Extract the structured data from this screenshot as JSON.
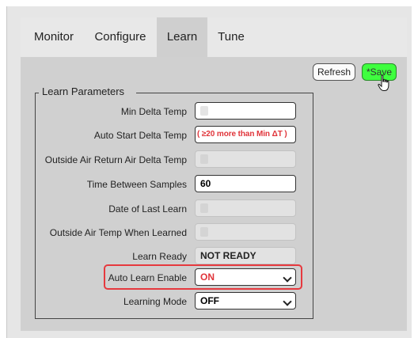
{
  "tabs": [
    {
      "label": "Monitor",
      "active": false
    },
    {
      "label": "Configure",
      "active": false
    },
    {
      "label": "Learn",
      "active": true
    },
    {
      "label": "Tune",
      "active": false
    }
  ],
  "toolbar": {
    "refresh_label": "Refresh",
    "save_label": "*Save"
  },
  "group": {
    "legend": "Learn Parameters"
  },
  "fields": {
    "min_delta_temp": {
      "label": "Min Delta Temp",
      "value": ""
    },
    "auto_start_delta_temp": {
      "label": "Auto Start Delta Temp",
      "placeholder": "( ≥20 more than Min ΔT )"
    },
    "oa_return_air_delta_temp": {
      "label": "Outside Air Return Air Delta Temp",
      "value": ""
    },
    "time_between_samples": {
      "label": "Time Between Samples",
      "value": "60"
    },
    "date_of_last_learn": {
      "label": "Date of Last Learn",
      "value": ""
    },
    "outside_air_temp_when_learned": {
      "label": "Outside Air Temp When Learned",
      "value": ""
    },
    "learn_ready": {
      "label": "Learn Ready",
      "value": "NOT READY"
    },
    "auto_learn_enable": {
      "label": "Auto Learn Enable",
      "value": "ON"
    },
    "learning_mode": {
      "label": "Learning Mode",
      "value": "OFF"
    }
  },
  "colors": {
    "accent_red": "#e6393e",
    "save_green": "#3fff3f",
    "hint_red": "#e0343a"
  },
  "icons": {
    "cursor": "hand-pointer-icon",
    "dropdown": "chevron-down-icon"
  }
}
